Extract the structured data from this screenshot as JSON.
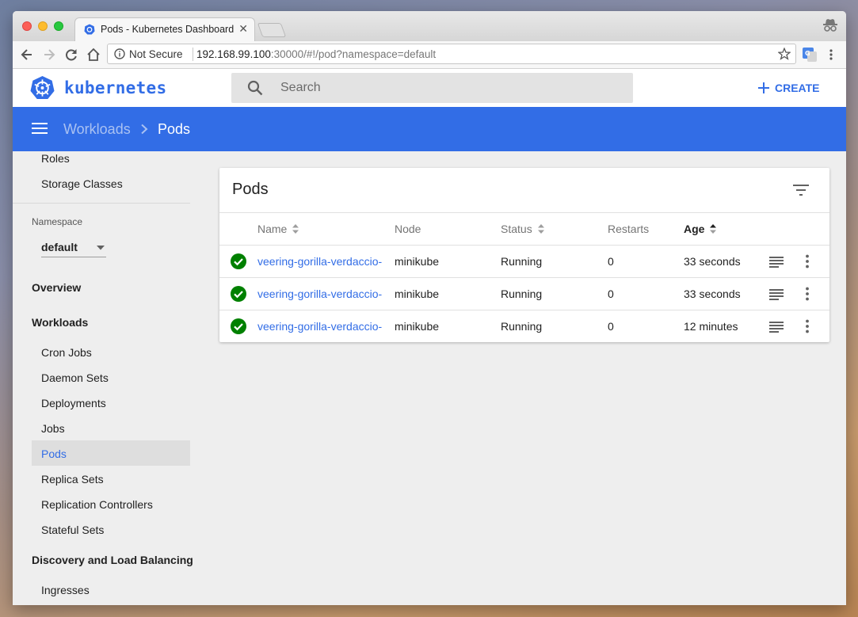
{
  "browser": {
    "tab_title": "Pods - Kubernetes Dashboard",
    "tab_close": "✕",
    "security_label": "Not Secure",
    "url_host": "192.168.99.100",
    "url_rest": ":30000/#!/pod?namespace=default"
  },
  "header": {
    "brand": "kubernetes",
    "search_placeholder": "Search",
    "create_label": "CREATE"
  },
  "breadcrumb": {
    "parent": "Workloads",
    "current": "Pods"
  },
  "sidebar": {
    "top_items": [
      "Roles",
      "Storage Classes"
    ],
    "namespace_label": "Namespace",
    "namespace_value": "default",
    "overview": "Overview",
    "workloads": "Workloads",
    "workload_items": [
      "Cron Jobs",
      "Daemon Sets",
      "Deployments",
      "Jobs",
      "Pods",
      "Replica Sets",
      "Replication Controllers",
      "Stateful Sets"
    ],
    "selected_item": "Pods",
    "discovery": "Discovery and Load Balancing",
    "discovery_items": [
      "Ingresses"
    ]
  },
  "pods": {
    "title": "Pods",
    "columns": {
      "name": "Name",
      "node": "Node",
      "status": "Status",
      "restarts": "Restarts",
      "age": "Age"
    },
    "rows": [
      {
        "name": "veering-gorilla-verdaccio-",
        "node": "minikube",
        "status": "Running",
        "restarts": "0",
        "age": "33 seconds"
      },
      {
        "name": "veering-gorilla-verdaccio-",
        "node": "minikube",
        "status": "Running",
        "restarts": "0",
        "age": "33 seconds"
      },
      {
        "name": "veering-gorilla-verdaccio-",
        "node": "minikube",
        "status": "Running",
        "restarts": "0",
        "age": "12 minutes"
      }
    ]
  },
  "colors": {
    "brand_blue": "#326de6",
    "status_ok": "#008000"
  }
}
